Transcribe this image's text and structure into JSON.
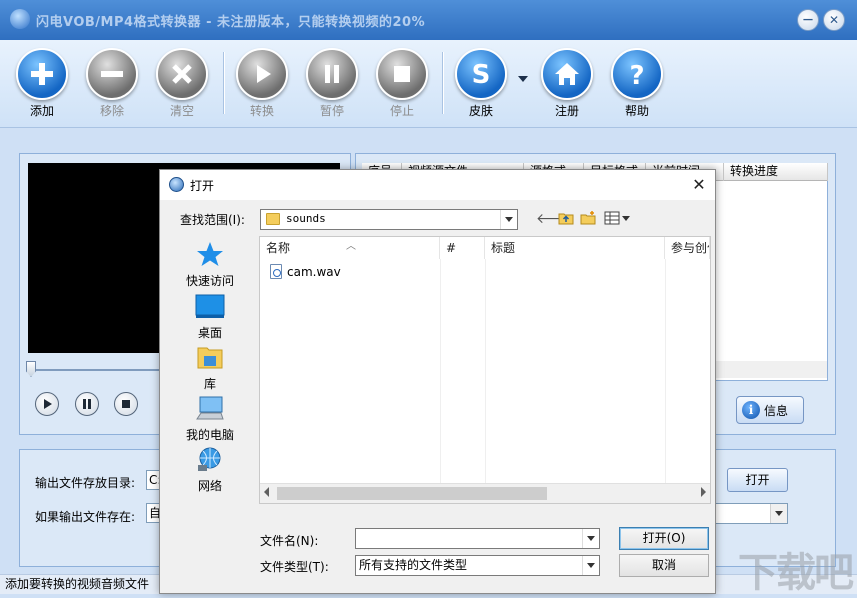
{
  "app": {
    "title": "闪电VOB/MP4格式转换器 - 未注册版本，只能转换视频的20%",
    "window_buttons": {
      "minimize": "－",
      "close": "✕"
    }
  },
  "toolbar": {
    "buttons": [
      {
        "label": "添加",
        "icon": "plus-icon",
        "enabled": true
      },
      {
        "label": "移除",
        "icon": "minus-icon",
        "enabled": false
      },
      {
        "label": "清空",
        "icon": "clear-icon",
        "enabled": false
      },
      {
        "label": "转换",
        "icon": "play-icon",
        "enabled": false
      },
      {
        "label": "暂停",
        "icon": "pause-icon",
        "enabled": false
      },
      {
        "label": "停止",
        "icon": "stop-icon",
        "enabled": false
      },
      {
        "label": "皮肤",
        "icon": "skin-icon",
        "enabled": true
      },
      {
        "label": "注册",
        "icon": "home-icon",
        "enabled": true
      },
      {
        "label": "帮助",
        "icon": "help-icon",
        "enabled": true
      }
    ]
  },
  "list": {
    "columns": [
      "序号",
      "视频源文件",
      "源格式",
      "目标格式",
      "当前时间",
      "转换进度"
    ]
  },
  "info_button": "信息",
  "output": {
    "dir_label": "输出文件存放目录:",
    "dir_value": "C:",
    "exists_label": "如果输出文件存在:",
    "exists_value": "自",
    "open_label": "打开"
  },
  "statusbar": {
    "text": "添加要转换的视频音频文件"
  },
  "watermark": "下载吧",
  "dialog": {
    "title": "打开",
    "lookin_label": "查找范围(I):",
    "lookin_value": "sounds",
    "places": [
      "快速访问",
      "桌面",
      "库",
      "我的电脑",
      "网络"
    ],
    "columns": [
      "名称",
      "#",
      "标题",
      "参与创作"
    ],
    "files": [
      "cam.wav"
    ],
    "filename_label": "文件名(N):",
    "filename_value": "",
    "filetype_label": "文件类型(T):",
    "filetype_value": "所有支持的文件类型",
    "open_button": "打开(O)",
    "cancel_button": "取消"
  },
  "colors": {
    "title_bar": "#3f7fcf",
    "toolbar_bg": "#dceafa",
    "accent_blue": "#1466c4",
    "disabled_grey": "#6e6e6e"
  }
}
